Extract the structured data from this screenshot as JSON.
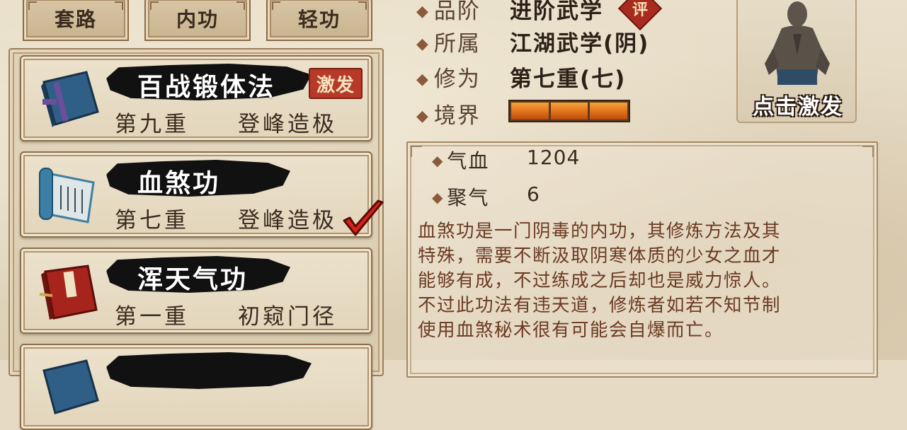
{
  "tabs": [
    "套路",
    "内功",
    "轻功"
  ],
  "skills": [
    {
      "name": "百战锻体法",
      "level": "第九重",
      "rank": "登峰造极",
      "badge": "激发",
      "book": "blue-book-icon",
      "selected": false
    },
    {
      "name": "血煞功",
      "level": "第七重",
      "rank": "登峰造极",
      "badge": "",
      "book": "scroll-icon",
      "selected": true
    },
    {
      "name": "浑天气功",
      "level": "第一重",
      "rank": "初窥门径",
      "badge": "",
      "book": "red-book-icon",
      "selected": false
    },
    {
      "name": "",
      "level": "",
      "rank": "",
      "badge": "",
      "book": "blue-book-icon",
      "selected": false
    }
  ],
  "info": {
    "grade_label": "品阶",
    "grade_value": "进阶武学",
    "grade_badge": "评",
    "belong_label": "所属",
    "belong_value": "江湖武学(阴)",
    "cultivation_label": "修为",
    "cultivation_value": "第七重(七)",
    "realm_label": "境界",
    "realm_segments": 3
  },
  "portrait": {
    "caption": "点击激发"
  },
  "stats": [
    {
      "label": "气血",
      "value": "1204"
    },
    {
      "label": "聚气",
      "value": "6"
    }
  ],
  "description": [
    "血煞功是一门阴毒的内功，其修炼方法及其",
    "特殊，需要不断汲取阴寒体质的少女之血才",
    "能够有成，不过练成之后却也是威力惊人。",
    "不过此功法有违天道，修炼者如若不知节制",
    "使用血煞秘术很有可能会自爆而亡。"
  ],
  "colors": {
    "accent_orange": "#e0701a",
    "stamp_red": "#b63a27",
    "desc_text": "#6b3a22"
  }
}
